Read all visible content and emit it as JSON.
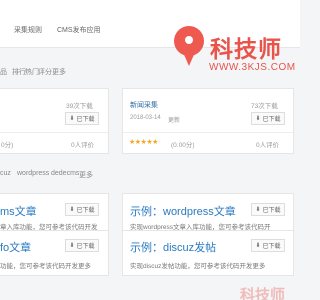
{
  "nav": {
    "items": [
      "采集规则",
      "CMS发布应用"
    ]
  },
  "filter_strip_1": {
    "items": [
      "品",
      "排行",
      "热门",
      "评分",
      "更多"
    ]
  },
  "filter_strip_2": {
    "items": [
      "cuz",
      "wordpress",
      "dedecms",
      "更多"
    ]
  },
  "logo": {
    "text": "科技师",
    "url": "WWW.3KJS.COM"
  },
  "download_label": "已下载",
  "row1": {
    "left": {
      "downloads": "39次下载",
      "score": "0分)",
      "reviews": "0人评价"
    },
    "right": {
      "title": "新闻采集",
      "downloads": "73次下载",
      "date": "2018-03-14",
      "status": "更新",
      "stars": "★★★★★",
      "score": "(0.00分)",
      "reviews": "0人评价"
    }
  },
  "row2": {
    "left": {
      "title": "ms文章",
      "desc": "章入库功能，您可参考该代码开发"
    },
    "right": {
      "title": "示例：wordpress文章",
      "desc": "实现wordpress文章入库功能，您可参考该代码开"
    }
  },
  "row3": {
    "left": {
      "title": "fo文章",
      "desc": "功能，您可参考该代码开发更多"
    },
    "right": {
      "title": "示例：discuz发帖",
      "desc": "实现discuz发帖功能，您可参考该代码开发更多"
    }
  },
  "watermark": "科技师"
}
